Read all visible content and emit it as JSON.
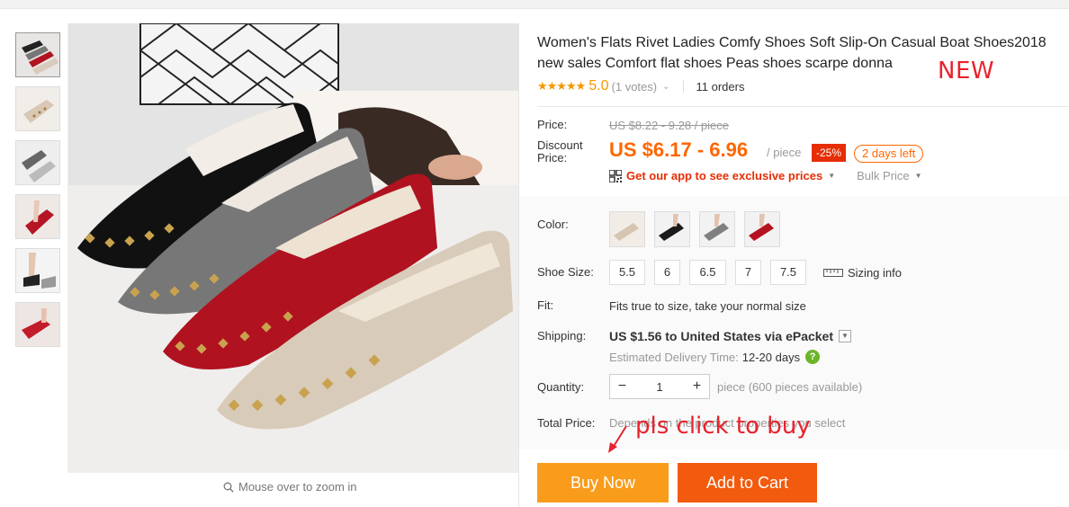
{
  "product": {
    "title": "Women's Flats Rivet Ladies Comfy Shoes Soft Slip-On Casual Boat Shoes2018 new sales Comfort flat shoes Peas shoes scarpe donna",
    "new_annotation": "NEW"
  },
  "rating": {
    "stars": "★★★★★",
    "score": "5.0",
    "votes": "(1 votes)",
    "orders": "11 orders"
  },
  "price": {
    "label": "Price:",
    "original": "US $8.22 - 9.28 / piece",
    "discount_label": "Discount Price:",
    "current": "US $6.17 - 6.96",
    "per_piece": "/ piece",
    "discount_badge": "-25%",
    "days_left": "2 days left",
    "app_promo": "Get our app to see exclusive prices",
    "bulk_price": "Bulk Price"
  },
  "specs": {
    "color_label": "Color:",
    "size_label": "Shoe Size:",
    "sizes": [
      "5.5",
      "6",
      "6.5",
      "7",
      "7.5"
    ],
    "sizing_info": "Sizing info",
    "fit_label": "Fit:",
    "fit_text": "Fits true to size, take your normal size",
    "shipping_label": "Shipping:",
    "shipping_text": "US $1.56 to United States via ePacket",
    "delivery_label": "Estimated Delivery Time:",
    "delivery_days": "12-20 days",
    "quantity_label": "Quantity:",
    "quantity_value": "1",
    "quantity_avail": "piece (600 pieces available)",
    "total_label": "Total Price:",
    "total_text": "Depends on the product properties you select"
  },
  "annotation": "pls click to buy",
  "gallery": {
    "zoom_hint": "Mouse over to zoom in"
  },
  "actions": {
    "buy_now": "Buy Now",
    "add_to_cart": "Add to Cart"
  },
  "colors": {
    "accent_orange": "#ff6600",
    "buy_button": "#f99c1c",
    "cart_button": "#f25a0d",
    "annotation_red": "#e8222d"
  }
}
